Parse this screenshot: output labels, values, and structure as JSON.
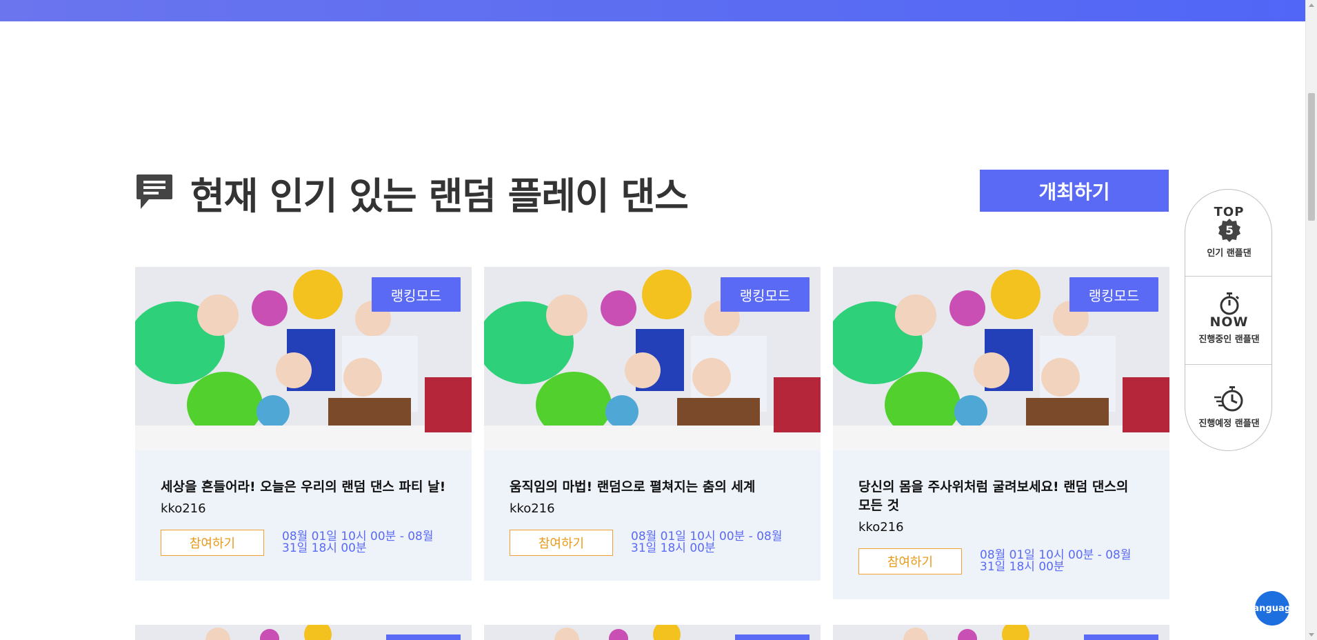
{
  "section": {
    "title": "현재 인기 있는 랜덤 플레이 댄스"
  },
  "host_button": "개최하기",
  "cards": [
    {
      "badge": "랭킹모드",
      "title": "세상을 흔들어라! 오늘은 우리의 랜덤 댄스 파티 날!",
      "author": "kko216",
      "join": "참여하기",
      "period": "08월 01일 10시 00분 - 08월 31일 18시 00분"
    },
    {
      "badge": "랭킹모드",
      "title": "움직임의 마법! 랜덤으로 펼쳐지는 춤의 세계",
      "author": "kko216",
      "join": "참여하기",
      "period": "08월 01일 10시 00분 - 08월 31일 18시 00분"
    },
    {
      "badge": "랭킹모드",
      "title": "당신의 몸을 주사위처럼 굴려보세요! 랜덤 댄스의 모든 것",
      "author": "kko216",
      "join": "참여하기",
      "period": "08월 01일 10시 00분 - 08월 31일 18시 00분"
    }
  ],
  "side_nav": {
    "top5": {
      "top_text": "TOP",
      "number": "5",
      "label": "인기 랜플댄"
    },
    "now": {
      "now_text": "NOW",
      "label": "진행중인 랜플댄"
    },
    "upcoming": {
      "label": "진행예정 랜플댄"
    }
  },
  "language_button": "Language",
  "colors": {
    "primary": "#5a6af5",
    "accent": "#e89a1a",
    "card_bg": "#eef2f9",
    "title": "#333333"
  }
}
